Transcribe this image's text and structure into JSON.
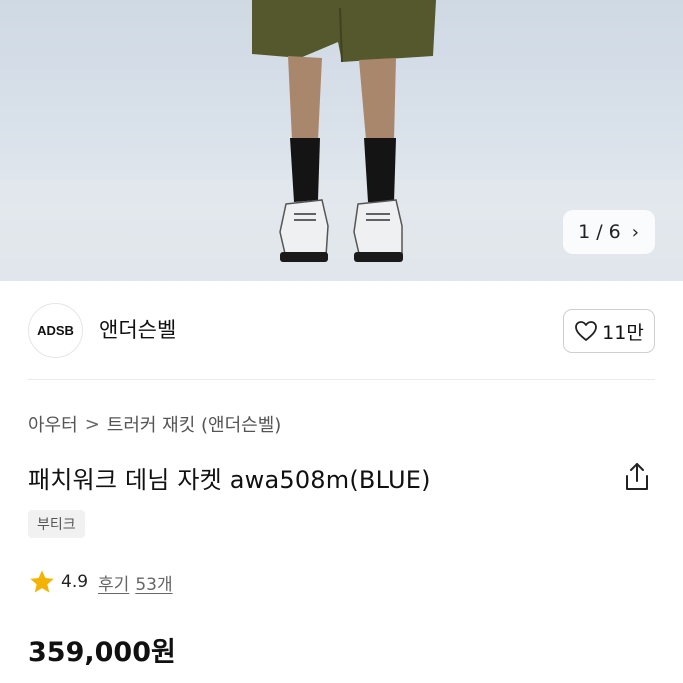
{
  "image": {
    "pager": {
      "current": "1",
      "separator": "/",
      "total": "6",
      "next_icon": "chevron-right-icon"
    }
  },
  "brand": {
    "logo_text": "ADSB",
    "name": "앤더슨벨",
    "likes": "11만",
    "like_icon": "heart-outline-icon"
  },
  "breadcrumb": {
    "category": "아우터",
    "separator": ">",
    "subcategory": "트러커 재킷 (앤더슨벨)"
  },
  "product": {
    "title": "패치워크 데님 자켓 awa508m(BLUE)",
    "share_icon": "share-icon",
    "badge": "부티크",
    "rating": "4.9",
    "review_label": "후기",
    "review_count": "53개",
    "price": "359,000원"
  },
  "colors": {
    "star": "#f5b301",
    "shorts": "#54582c",
    "sky": "#d3dde7"
  }
}
